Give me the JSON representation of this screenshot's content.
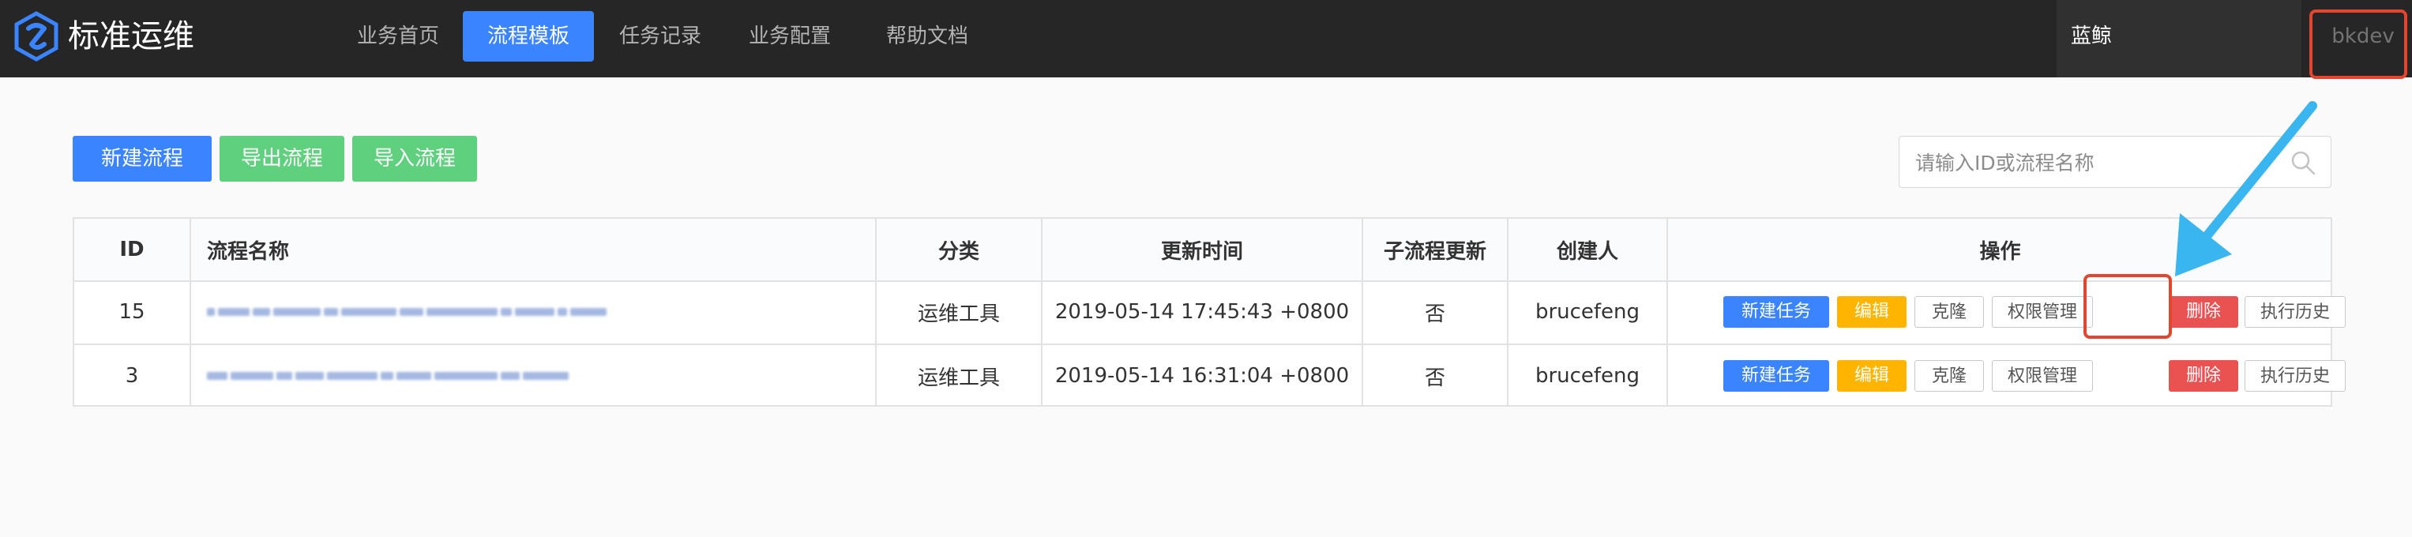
{
  "app": {
    "logo_text": "标准运维"
  },
  "nav": {
    "items": [
      {
        "label": "业务首页"
      },
      {
        "label": "流程模板"
      },
      {
        "label": "任务记录"
      },
      {
        "label": "业务配置"
      },
      {
        "label": "帮助文档"
      }
    ],
    "active_index": 1
  },
  "header": {
    "project": "蓝鲸",
    "user": "bkdev"
  },
  "toolbar": {
    "new_flow": "新建流程",
    "export_flow": "导出流程",
    "import_flow": "导入流程"
  },
  "search": {
    "placeholder": "请输入ID或流程名称"
  },
  "table": {
    "columns": [
      "ID",
      "流程名称",
      "分类",
      "更新时间",
      "子流程更新",
      "创建人",
      "操作"
    ],
    "rows": [
      {
        "id": "15",
        "category": "运维工具",
        "updated": "2019-05-14 17:45:43 +0800",
        "subflow_update": "否",
        "creator": "brucefeng"
      },
      {
        "id": "3",
        "category": "运维工具",
        "updated": "2019-05-14 16:31:04 +0800",
        "subflow_update": "否",
        "creator": "brucefeng"
      }
    ],
    "actions": {
      "new_task": "新建任务",
      "edit": "编辑",
      "clone": "克隆",
      "permission": "权限管理",
      "delete": "删除",
      "history": "执行历史"
    }
  },
  "colors": {
    "topbar": "#262626",
    "accent_blue": "#3a84ff",
    "green": "#5fd07d",
    "orange": "#ffb400",
    "red": "#ea5151",
    "annotation_red": "#e4452f",
    "annotation_arrow": "#39b5ef"
  }
}
